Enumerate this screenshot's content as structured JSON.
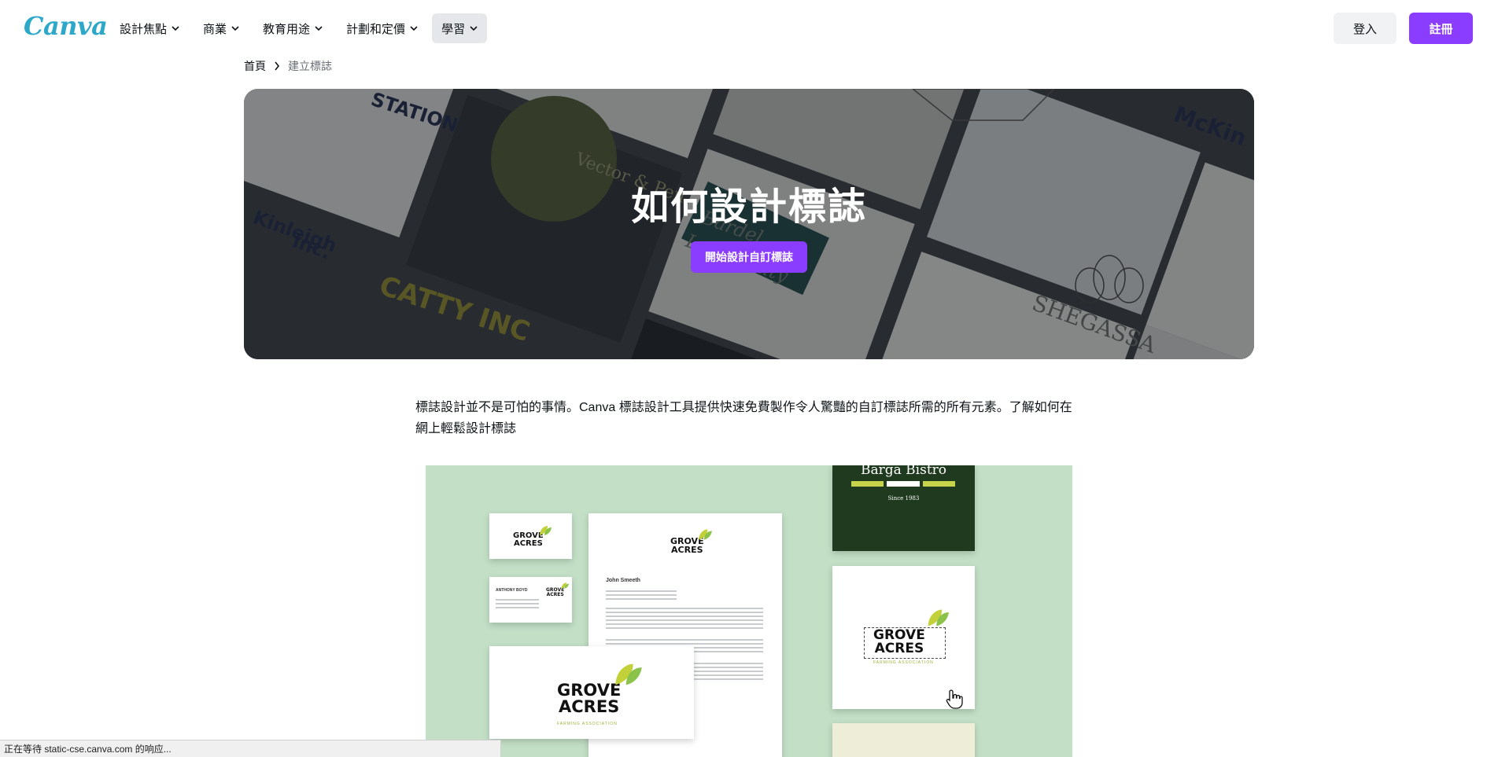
{
  "header": {
    "logo": "Canva",
    "nav": [
      {
        "label": "設計焦點"
      },
      {
        "label": "商業"
      },
      {
        "label": "教育用途"
      },
      {
        "label": "計劃和定價"
      },
      {
        "label": "學習"
      }
    ],
    "login_label": "登入",
    "signup_label": "註冊",
    "accent_color": "#8b3dff"
  },
  "breadcrumb": {
    "home": "首頁",
    "current": "建立標誌"
  },
  "hero": {
    "title": "如何設計標誌",
    "cta_label": "開始設計自訂標誌",
    "background_texts": [
      "STATION",
      "Vector & Pen",
      "Kinleigh Inc.",
      "Bardel Low Realty",
      "CATTY INC",
      "McKin",
      "SHEGASSA"
    ]
  },
  "intro": {
    "text": "標誌設計並不是可怕的事情。Canva 標誌設計工具提供快速免費製作令人驚豔的自訂標誌所需的所有元素。了解如何在網上輕鬆設計標誌"
  },
  "showcase": {
    "brand_line1": "GROVE",
    "brand_line2": "ACRES",
    "brand_tagline": "FARMING ASSOCIATION",
    "letter_recipient": "John Smeeth",
    "card_name": "ANTHONY BOYD",
    "bistro_name": "Barga Bistro",
    "bistro_since": "Since 1983"
  },
  "status": {
    "text": "正在等待 static-cse.canva.com 的响应..."
  }
}
